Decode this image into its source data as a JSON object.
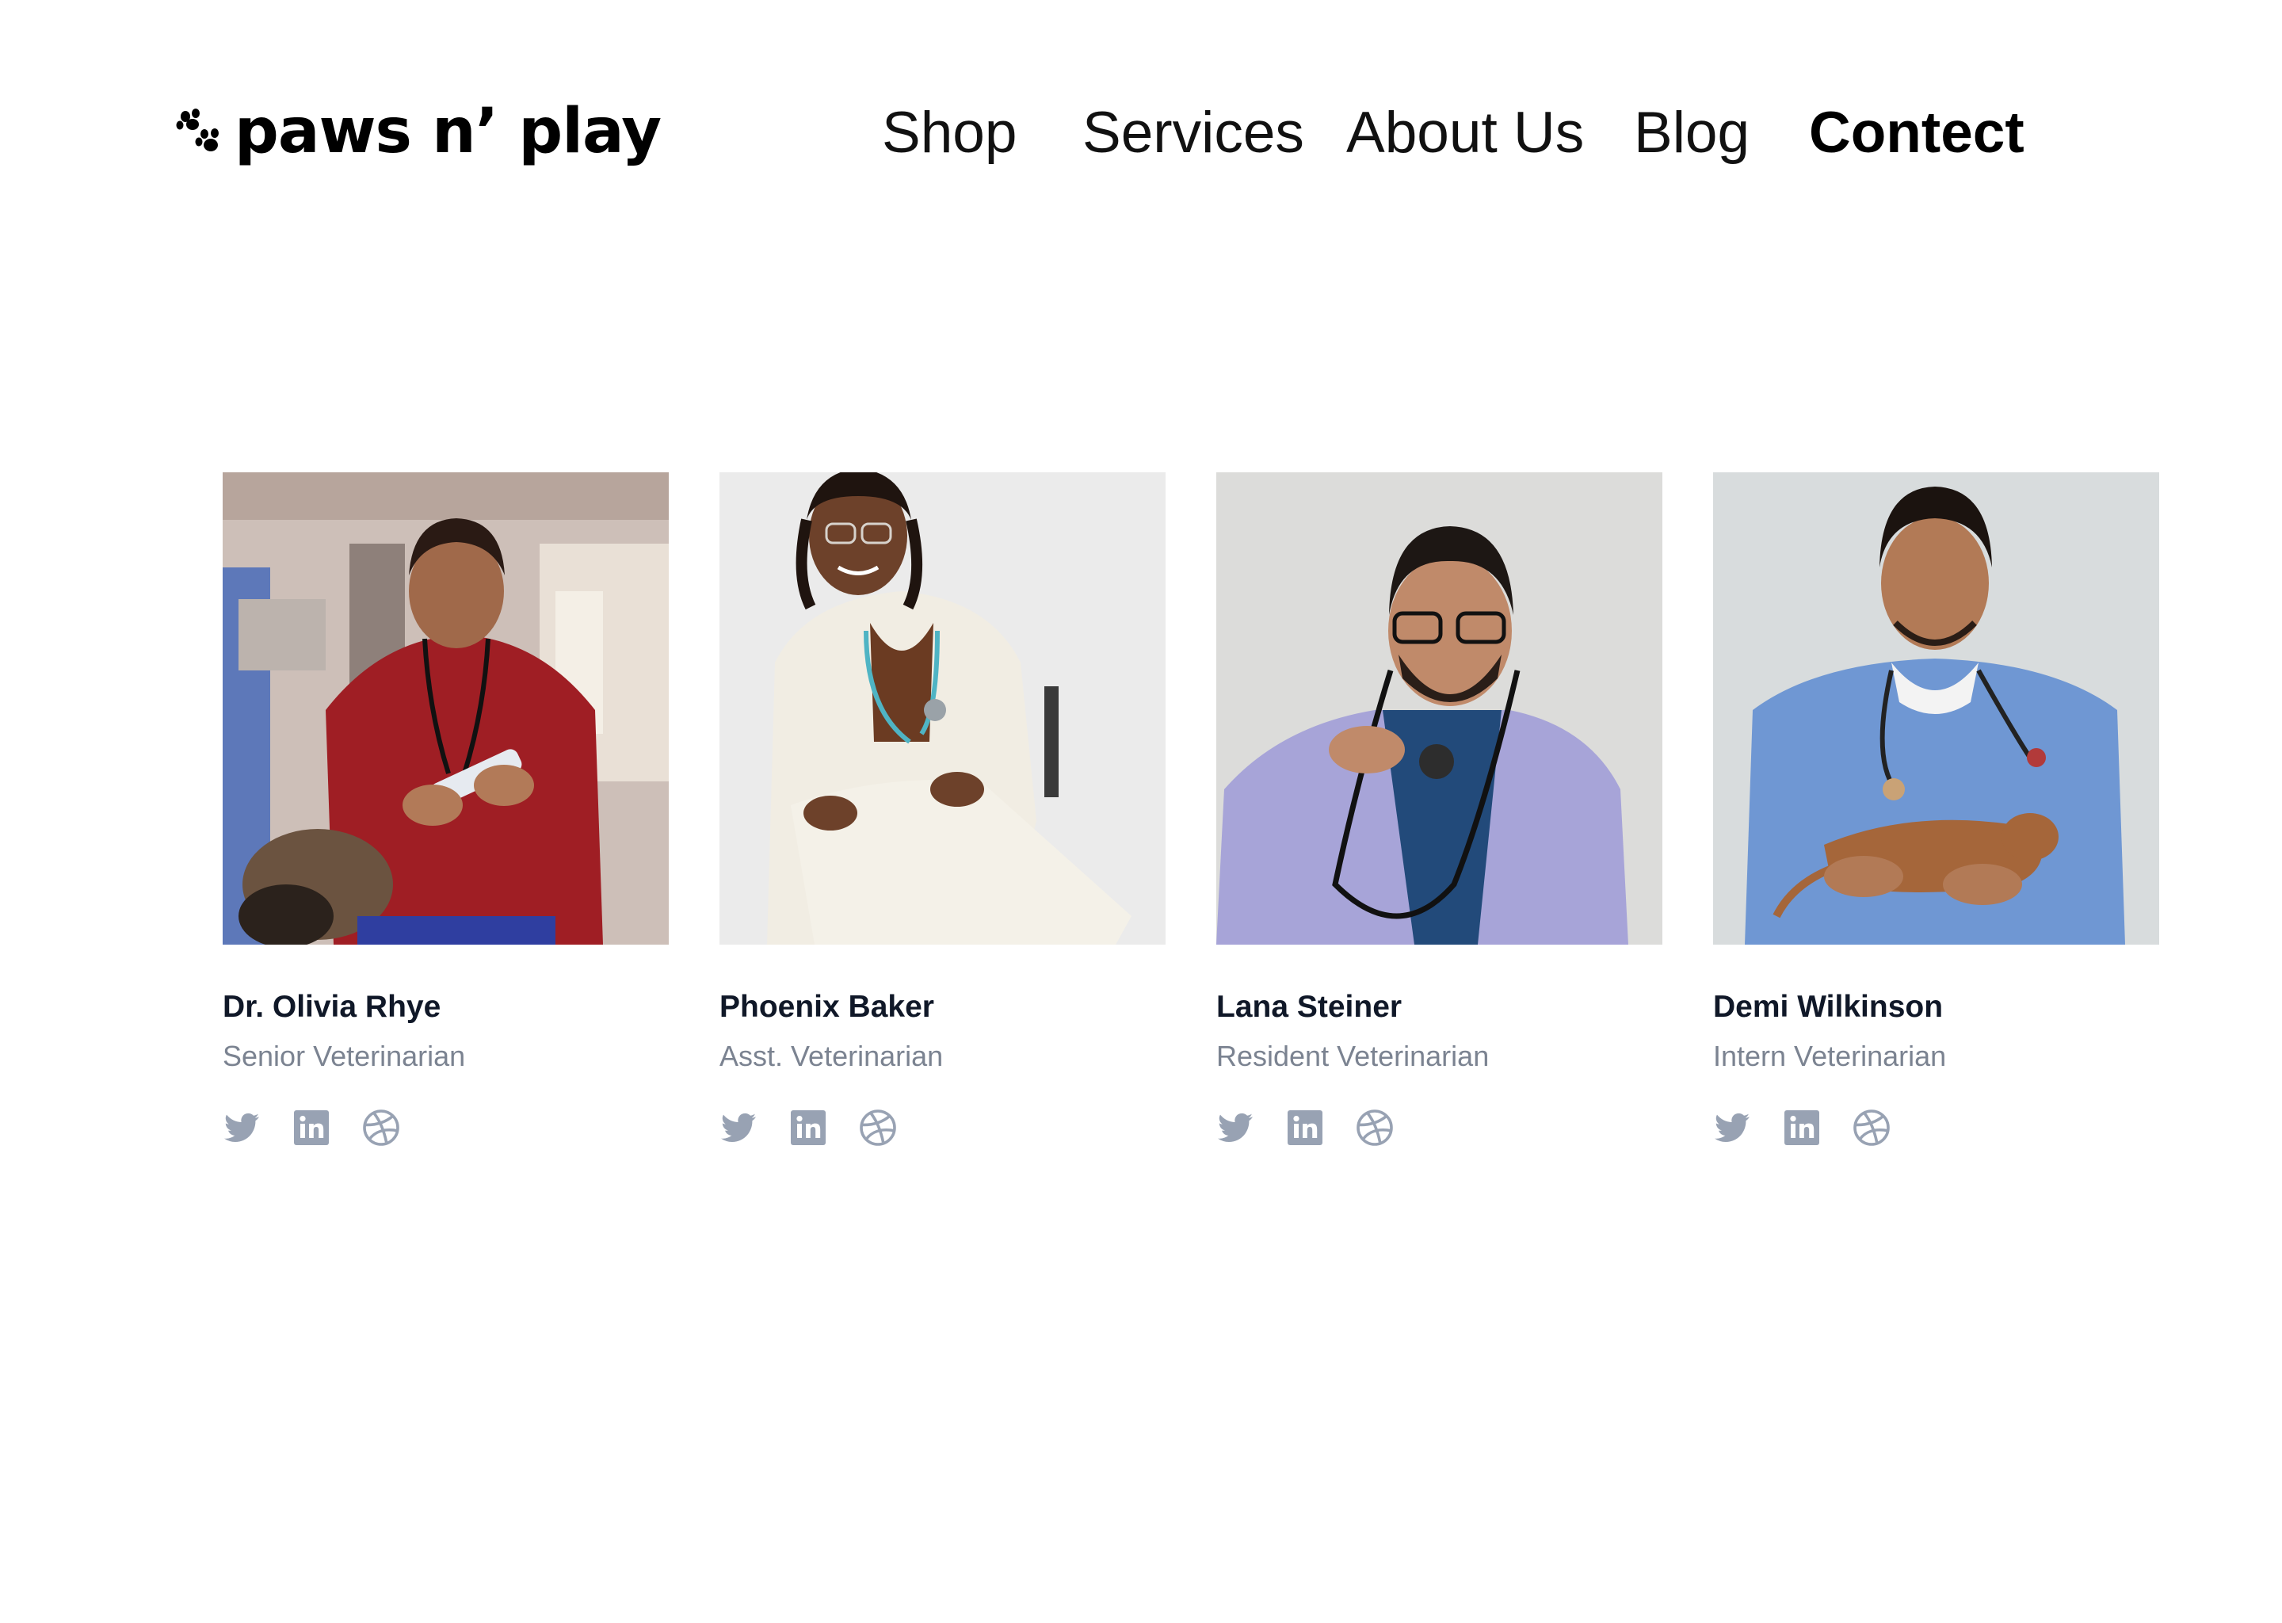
{
  "brand": {
    "name": "paws n’ play",
    "logo_icon": "paw-icon"
  },
  "nav": {
    "items": [
      {
        "label": "Shop",
        "active": false
      },
      {
        "label": "Services",
        "active": false
      },
      {
        "label": "About Us",
        "active": false
      },
      {
        "label": "Blog",
        "active": false
      },
      {
        "label": "Contect",
        "active": true
      }
    ]
  },
  "team": {
    "members": [
      {
        "name": "Dr. Olivia Rhye",
        "role": "Senior Veterinarian",
        "photo": "portrait-photo-red-scrubs",
        "socials": [
          "twitter-icon",
          "linkedin-icon",
          "dribbble-icon"
        ]
      },
      {
        "name": "Phoenix Baker",
        "role": "Asst. Veterinarian",
        "photo": "portrait-photo-white-suit",
        "socials": [
          "twitter-icon",
          "linkedin-icon",
          "dribbble-icon"
        ]
      },
      {
        "name": "Lana Steiner",
        "role": "Resident Veterinarian",
        "photo": "portrait-photo-lavender-coat",
        "socials": [
          "twitter-icon",
          "linkedin-icon",
          "dribbble-icon"
        ]
      },
      {
        "name": "Demi Wilkinson",
        "role": "Intern Veterinarian",
        "photo": "portrait-photo-blue-scrubs",
        "socials": [
          "twitter-icon",
          "linkedin-icon",
          "dribbble-icon"
        ]
      }
    ]
  },
  "colors": {
    "nav_text": "#111111",
    "name_text": "#101828",
    "role_text": "#7b8391",
    "social_icon": "#98a2b3",
    "background": "#ffffff"
  }
}
